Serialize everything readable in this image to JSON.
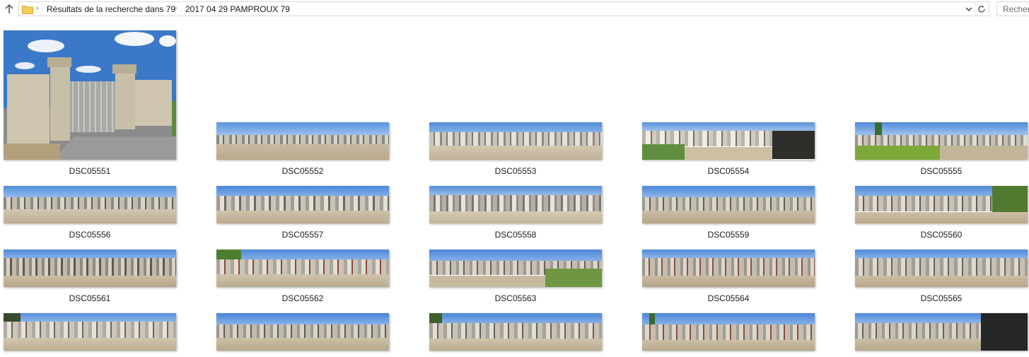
{
  "address_bar": {
    "breadcrumbs": [
      "Résultats de la recherche dans 79",
      "2017 04 29 PAMPROUX 79"
    ],
    "search_placeholder": "Recher"
  },
  "icons": {
    "up": "arrow-up-icon",
    "folder": "folder-icon",
    "separator": "chevron-right-icon",
    "dropdown": "chevron-down-icon",
    "refresh": "refresh-icon"
  },
  "files": [
    {
      "name": "DSC05551"
    },
    {
      "name": "DSC05552"
    },
    {
      "name": "DSC05553"
    },
    {
      "name": "DSC05554"
    },
    {
      "name": "DSC05555"
    },
    {
      "name": "DSC05556"
    },
    {
      "name": "DSC05557"
    },
    {
      "name": "DSC05558"
    },
    {
      "name": "DSC05559"
    },
    {
      "name": "DSC05560"
    },
    {
      "name": "DSC05561"
    },
    {
      "name": "DSC05562"
    },
    {
      "name": "DSC05563"
    },
    {
      "name": "DSC05564"
    },
    {
      "name": "DSC05565"
    },
    {
      "name": ""
    },
    {
      "name": ""
    },
    {
      "name": ""
    },
    {
      "name": ""
    },
    {
      "name": ""
    }
  ]
}
